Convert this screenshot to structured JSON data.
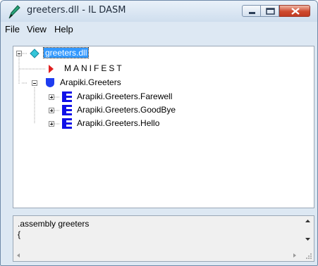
{
  "window": {
    "title": "greeters.dll - IL DASM",
    "icon": "ildasm-pen-icon"
  },
  "menu": {
    "items": [
      "File",
      "View",
      "Help"
    ]
  },
  "tree": {
    "root": {
      "label": "greeters.dll",
      "icon": "assembly-diamond-icon",
      "selected": true
    },
    "manifest": {
      "label": "MANIFEST",
      "icon": "manifest-arrow-icon",
      "color": "#e02020"
    },
    "namespace": {
      "label": "Arapiki.Greeters",
      "icon": "namespace-shield-icon",
      "color": "#1e3cf0"
    },
    "classes": [
      {
        "label": "Arapiki.Greeters.Farewell",
        "icon": "class-icon"
      },
      {
        "label": "Arapiki.Greeters.GoodBye",
        "icon": "class-icon"
      },
      {
        "label": "Arapiki.Greeters.Hello",
        "icon": "class-icon"
      }
    ]
  },
  "output": {
    "line1": ".assembly greeters",
    "line2": "{"
  },
  "colors": {
    "selection": "#3399ff",
    "class_blue": "#1010e8",
    "close_red": "#cf4a2f"
  }
}
